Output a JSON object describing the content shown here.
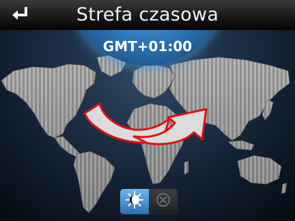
{
  "header": {
    "title": "Strefa czasowa",
    "back_icon": "return-arrow-icon"
  },
  "timezone": {
    "offset": "GMT+01:00"
  },
  "summer_time_toggle": {
    "on_icon": "sun-moon-icon",
    "off_icon": "circle-x-icon",
    "selected": "on"
  },
  "colors": {
    "accent": "#2f79ba",
    "arrow_fill": "#dcdcdc",
    "arrow_stroke": "#e01010"
  }
}
